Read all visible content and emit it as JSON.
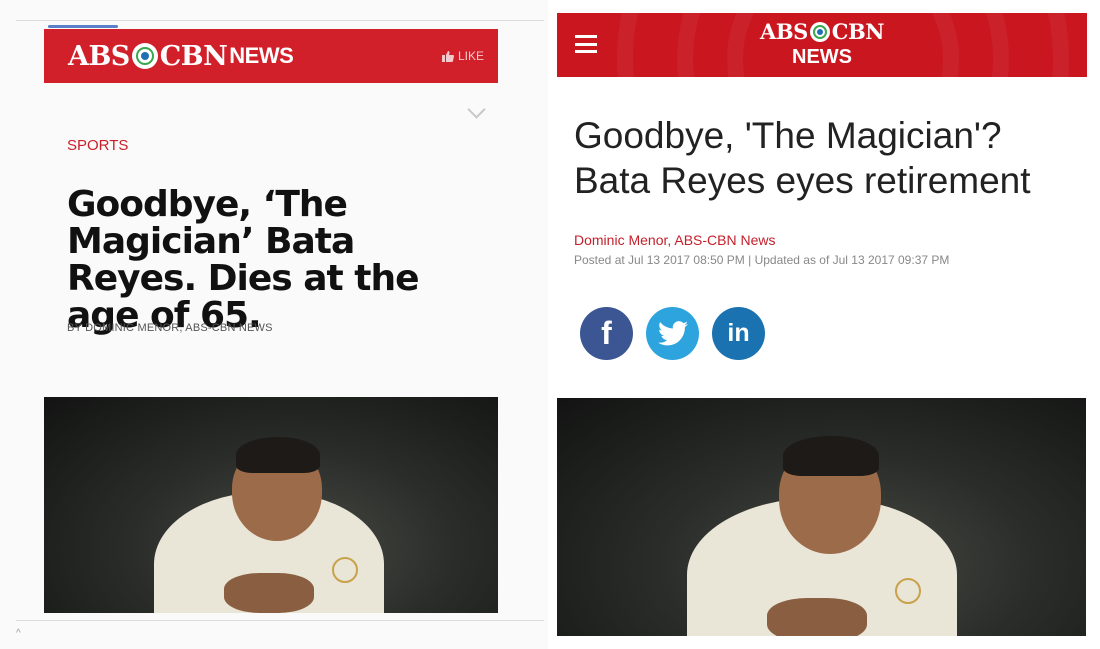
{
  "left": {
    "brand": {
      "abs": "ABS",
      "cbn": "CBN",
      "news": "NEWS"
    },
    "like_label": "LIKE",
    "section": "SPORTS",
    "title": "Goodbye, ‘The Magician’ Bata Reyes. Dies at  the age of 65.",
    "byline": "BY DOMINIC MENOR, ABS-CBN NEWS",
    "caret": "^"
  },
  "right": {
    "brand": {
      "abs": "ABS",
      "cbn": "CBN",
      "news": "NEWS"
    },
    "title": "Goodbye, 'The Magician'? Bata Reyes eyes retirement",
    "author": "Dominic Menor, ABS-CBN News",
    "posted": "Posted at Jul 13 2017 08:50 PM | Updated as of Jul 13 2017 09:37 PM",
    "share": {
      "facebook": "f",
      "linkedin": "in"
    }
  },
  "colors": {
    "brand_red": "#d1202a",
    "facebook": "#3b5693",
    "twitter": "#2ea4df",
    "linkedin": "#1a73b0"
  },
  "icons": [
    "thumbs-up-icon",
    "chevron-down-icon",
    "menu-icon",
    "facebook-icon",
    "twitter-icon",
    "linkedin-icon"
  ]
}
